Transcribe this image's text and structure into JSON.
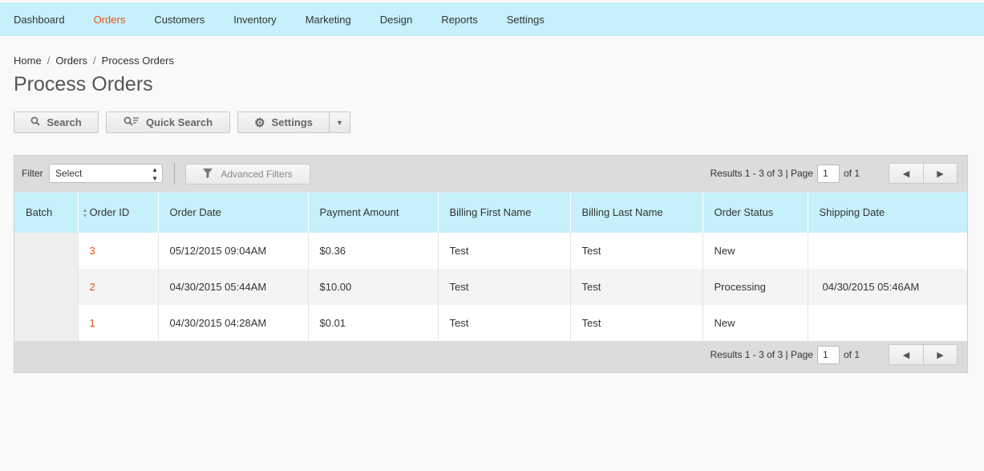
{
  "nav": {
    "items": [
      {
        "label": "Dashboard",
        "active": false
      },
      {
        "label": "Orders",
        "active": true
      },
      {
        "label": "Customers",
        "active": false
      },
      {
        "label": "Inventory",
        "active": false
      },
      {
        "label": "Marketing",
        "active": false
      },
      {
        "label": "Design",
        "active": false
      },
      {
        "label": "Reports",
        "active": false
      },
      {
        "label": "Settings",
        "active": false
      }
    ]
  },
  "breadcrumb": [
    "Home",
    "Orders",
    "Process Orders"
  ],
  "page_title": "Process Orders",
  "toolbar": {
    "search_label": "Search",
    "quick_search_label": "Quick Search",
    "settings_label": "Settings"
  },
  "filter": {
    "label": "Filter",
    "select_value": "Select",
    "advanced_label": "Advanced Filters"
  },
  "pager": {
    "results_text": "Results 1 - 3 of 3 |",
    "page_label": "Page",
    "page_value": "1",
    "of_text": "of 1"
  },
  "table": {
    "columns": [
      "Batch",
      "Order ID",
      "Order Date",
      "Payment Amount",
      "Billing First Name",
      "Billing Last Name",
      "Order Status",
      "Shipping Date"
    ],
    "rows": [
      {
        "batch": "",
        "order_id": "3",
        "order_date": "05/12/2015 09:04AM",
        "payment": "$0.36",
        "first": "Test",
        "last": "Test",
        "status": "New",
        "ship": ""
      },
      {
        "batch": "",
        "order_id": "2",
        "order_date": "04/30/2015 05:44AM",
        "payment": "$10.00",
        "first": "Test",
        "last": "Test",
        "status": "Processing",
        "ship": "04/30/2015 05:46AM"
      },
      {
        "batch": "",
        "order_id": "1",
        "order_date": "04/30/2015 04:28AM",
        "payment": "$0.01",
        "first": "Test",
        "last": "Test",
        "status": "New",
        "ship": ""
      }
    ]
  },
  "colors": {
    "nav_bg": "#c6f1fb",
    "accent": "#e8531c"
  },
  "icons": {
    "search": "search-icon",
    "quick_search": "quick-search-icon",
    "settings": "gear-icon",
    "caret": "caret-down-icon",
    "filter": "funnel-icon",
    "prev": "prev-page-icon",
    "next": "next-page-icon",
    "sort": "sort-icon"
  }
}
